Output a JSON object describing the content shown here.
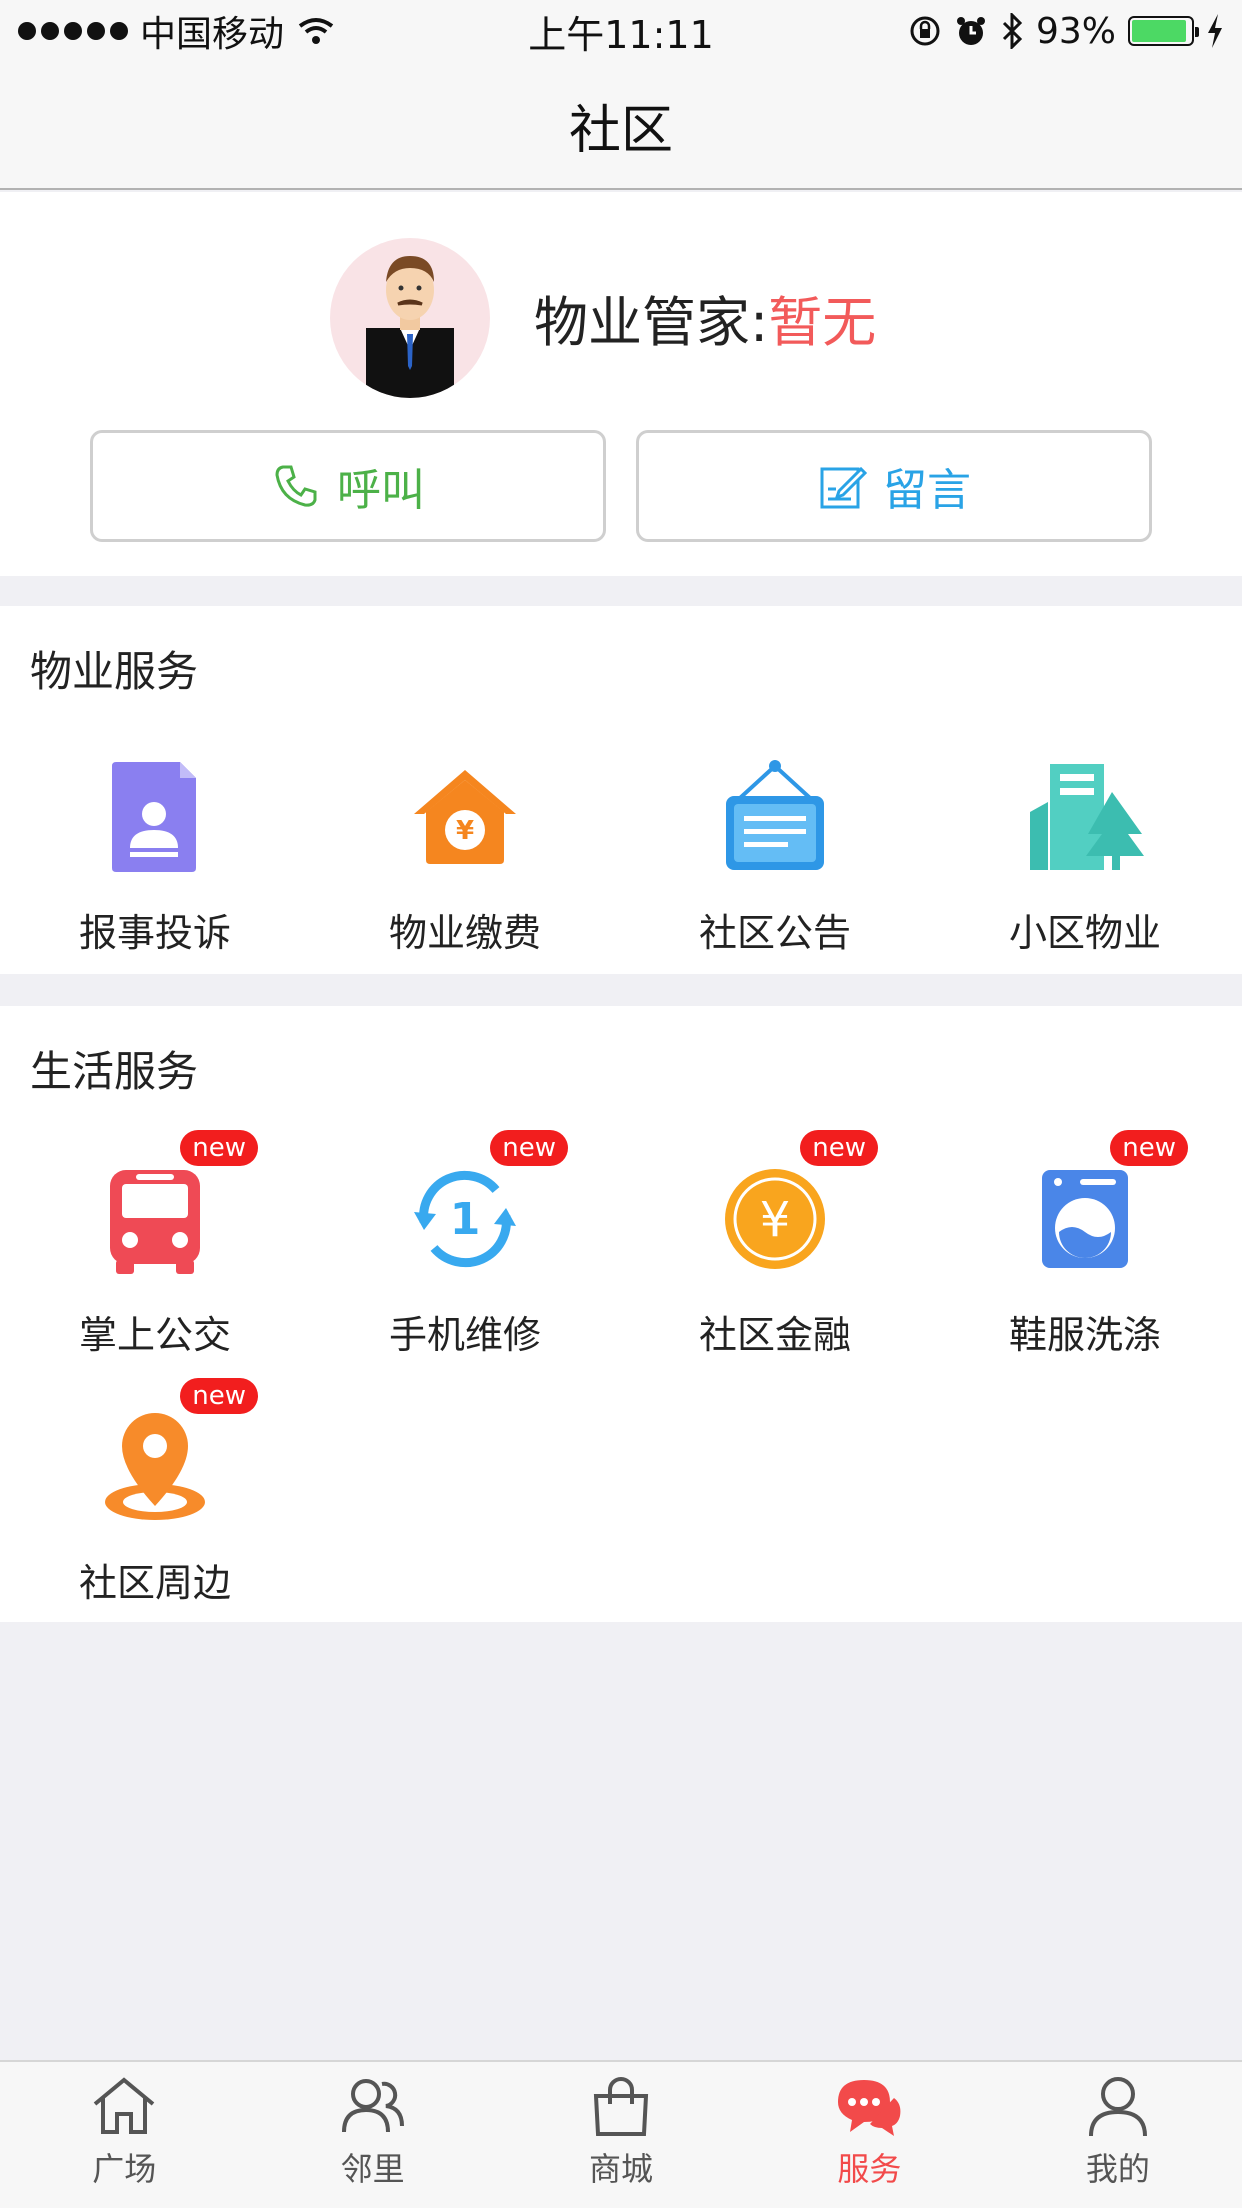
{
  "status_bar": {
    "carrier": "中国移动",
    "time": "上午11:11",
    "battery": "93%",
    "battery_level": 0.93
  },
  "nav": {
    "title": "社区"
  },
  "manager": {
    "label": "物业管家:",
    "value": "暂无",
    "call_label": "呼叫",
    "message_label": "留言"
  },
  "property_services": {
    "title": "物业服务",
    "items": [
      {
        "label": "报事投诉",
        "icon": "complaint-report-icon"
      },
      {
        "label": "物业缴费",
        "icon": "house-payment-icon"
      },
      {
        "label": "社区公告",
        "icon": "notice-board-icon"
      },
      {
        "label": "小区物业",
        "icon": "building-tree-icon"
      }
    ]
  },
  "life_services": {
    "title": "生活服务",
    "badge": "new",
    "items": [
      {
        "label": "掌上公交",
        "icon": "bus-icon"
      },
      {
        "label": "手机维修",
        "icon": "repair-cycle-icon"
      },
      {
        "label": "社区金融",
        "icon": "yuan-coin-icon"
      },
      {
        "label": "鞋服洗涤",
        "icon": "washing-machine-icon"
      },
      {
        "label": "社区周边",
        "icon": "location-pin-icon"
      }
    ]
  },
  "tabs": [
    {
      "label": "广场",
      "icon": "home-icon",
      "active": false
    },
    {
      "label": "邻里",
      "icon": "neighbors-icon",
      "active": false
    },
    {
      "label": "商城",
      "icon": "shopping-bag-icon",
      "active": false
    },
    {
      "label": "服务",
      "icon": "chat-bubble-icon",
      "active": true
    },
    {
      "label": "我的",
      "icon": "person-icon",
      "active": false
    }
  ],
  "colors": {
    "accent_red": "#f24a4a",
    "call_green": "#4cb148",
    "message_blue": "#29a3e6",
    "badge_red": "#f21e1e"
  }
}
